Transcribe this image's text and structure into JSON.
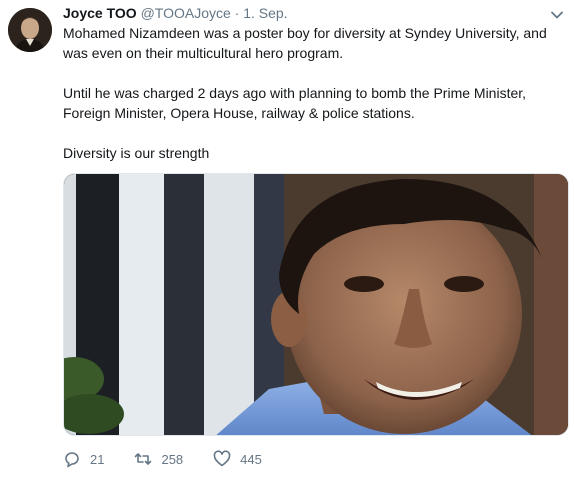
{
  "tweet": {
    "author_name": "Joyce TOO",
    "author_handle": "@TOOAJoyce",
    "separator": "·",
    "date": "1. Sep.",
    "paragraphs": [
      "Mohamed Nizamdeen was a poster boy for diversity at Syndey University, and was even on their multicultural hero program.",
      "Until he was charged 2 days ago with planning to bomb the Prime Minister, Foreign Minister, Opera House, railway & police stations.",
      "Diversity is our strength"
    ]
  },
  "actions": {
    "replies": "21",
    "retweets": "258",
    "likes": "445"
  },
  "icons": {
    "reply": "reply-icon",
    "retweet": "retweet-icon",
    "like": "heart-icon",
    "menu": "chevron-down-icon"
  },
  "colors": {
    "text": "#14171a",
    "muted": "#657786",
    "border": "#e1e8ed"
  }
}
